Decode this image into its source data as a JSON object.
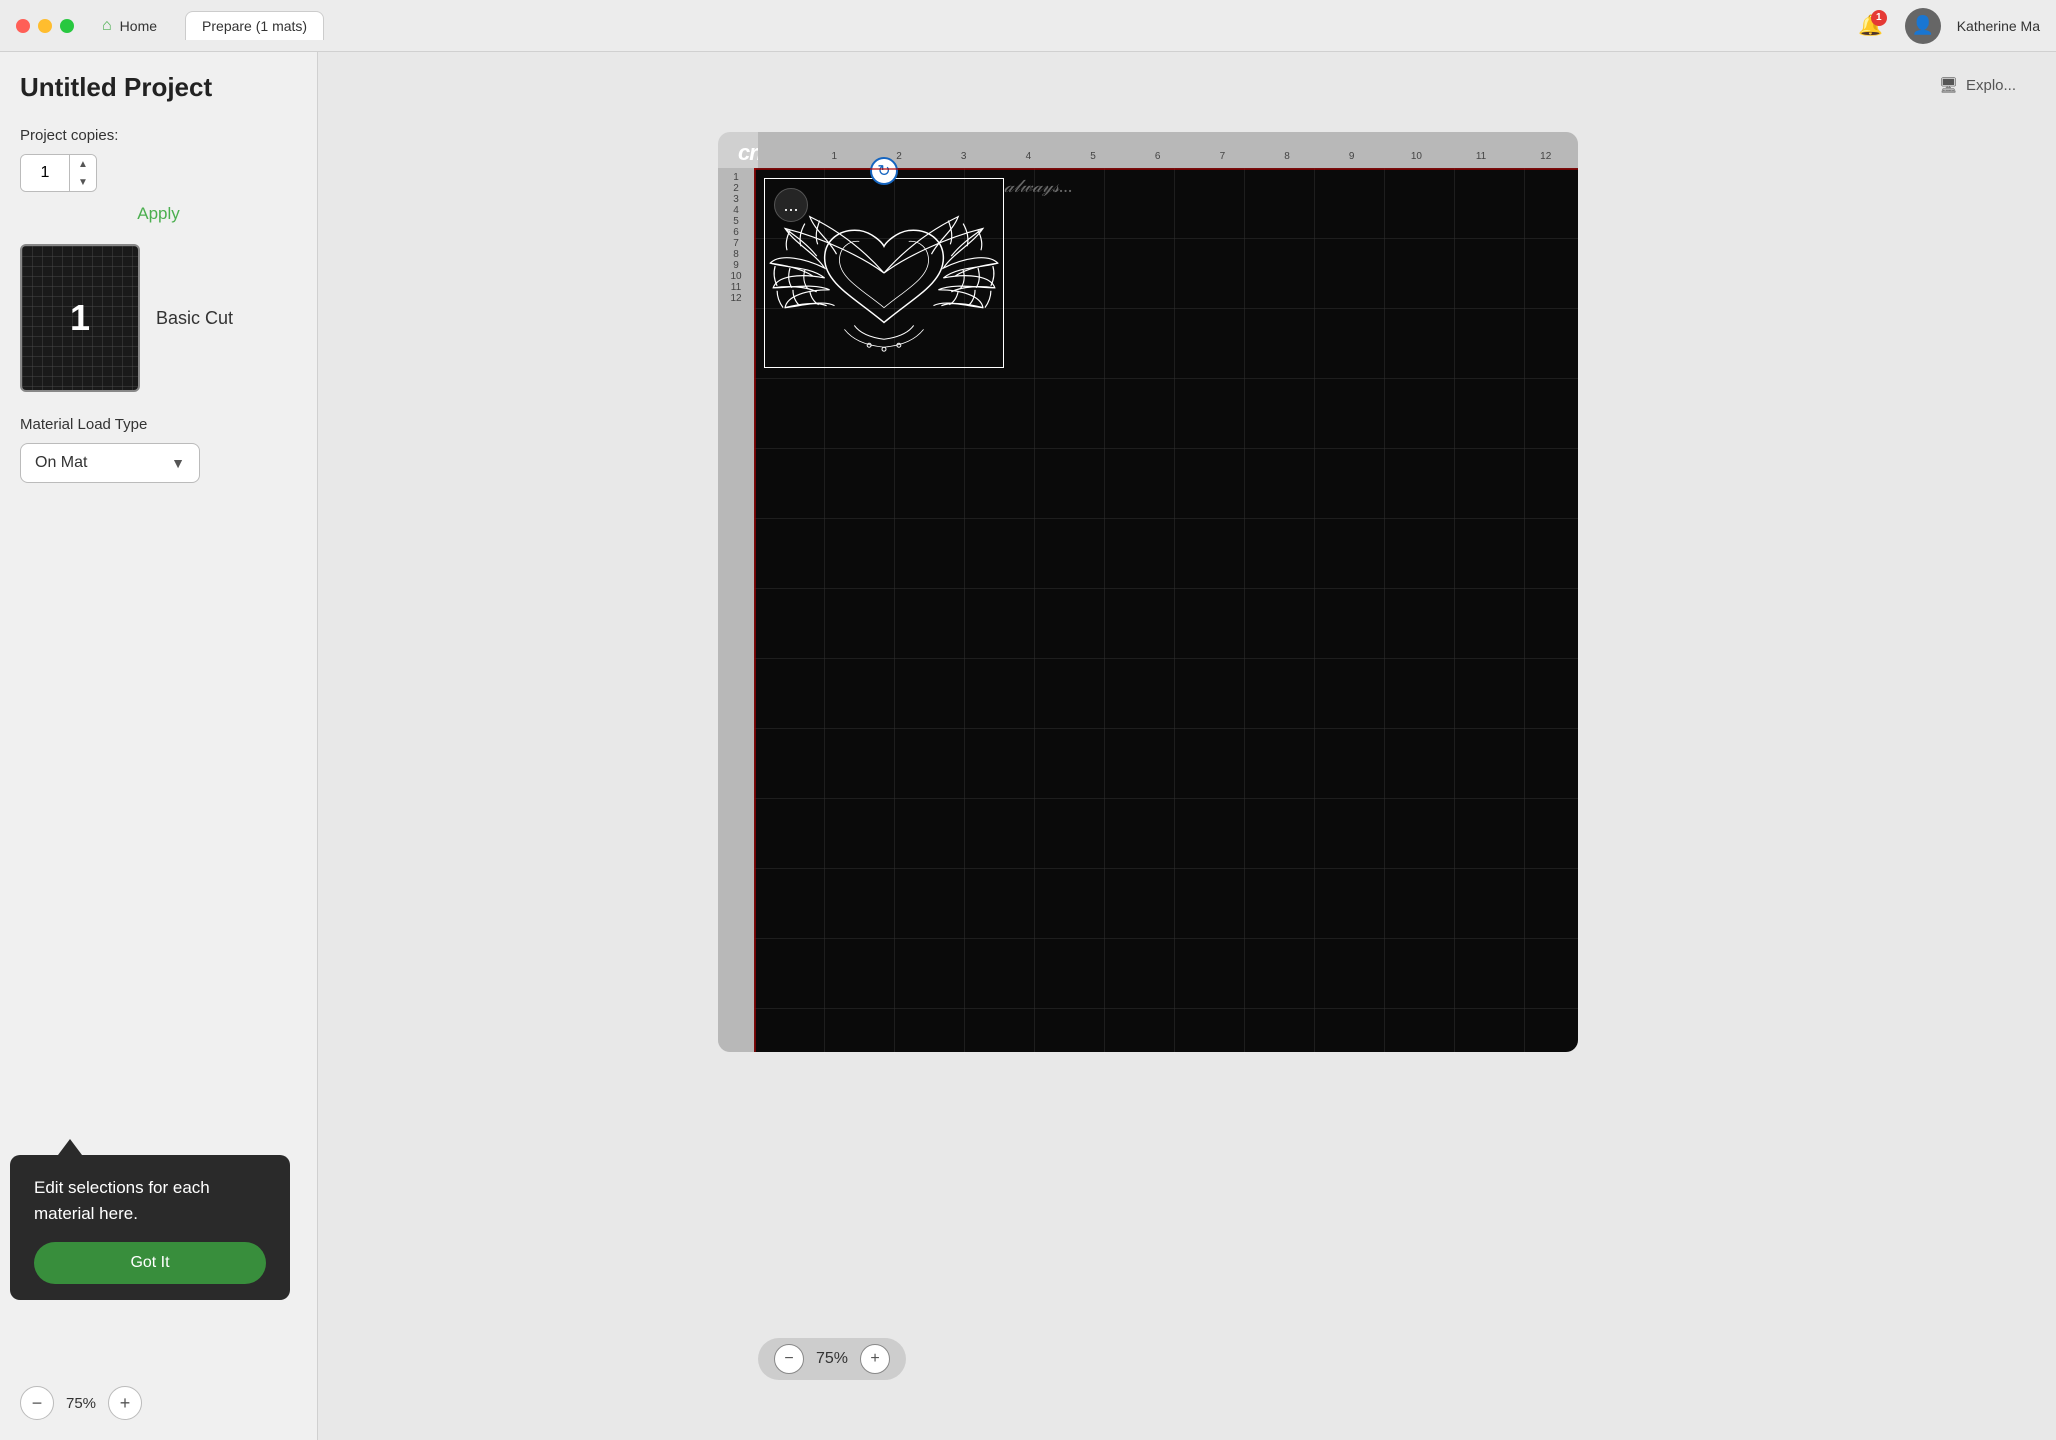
{
  "titlebar": {
    "tab_home": "Home",
    "tab_prepare": "Prepare (1 mats)",
    "notification_count": "1",
    "username": "Katherine Ma"
  },
  "sidebar": {
    "project_title": "Untitled Project",
    "project_copies_label": "Project copies:",
    "copies_value": "1",
    "apply_label": "Apply",
    "mat_number": "1",
    "mat_label": "Basic Cut",
    "material_load_label": "Material Load Type",
    "on_mat_label": "On Mat",
    "tooltip": {
      "text": "Edit selections for each material here.",
      "button_label": "Got It"
    }
  },
  "canvas": {
    "cricut_logo": "cricut",
    "explore_label": "Explo...",
    "zoom_level": "75%",
    "ruler_h": [
      "1",
      "2",
      "3",
      "4",
      "5",
      "6",
      "7",
      "8",
      "9",
      "10",
      "11",
      "12"
    ],
    "ruler_v": [
      "1",
      "2",
      "3",
      "4",
      "5",
      "6",
      "7",
      "8",
      "9",
      "10",
      "11",
      "12"
    ]
  },
  "more_options": "...",
  "zoom_minus": "−",
  "zoom_plus": "+",
  "spin_up": "▲",
  "spin_down": "▼"
}
